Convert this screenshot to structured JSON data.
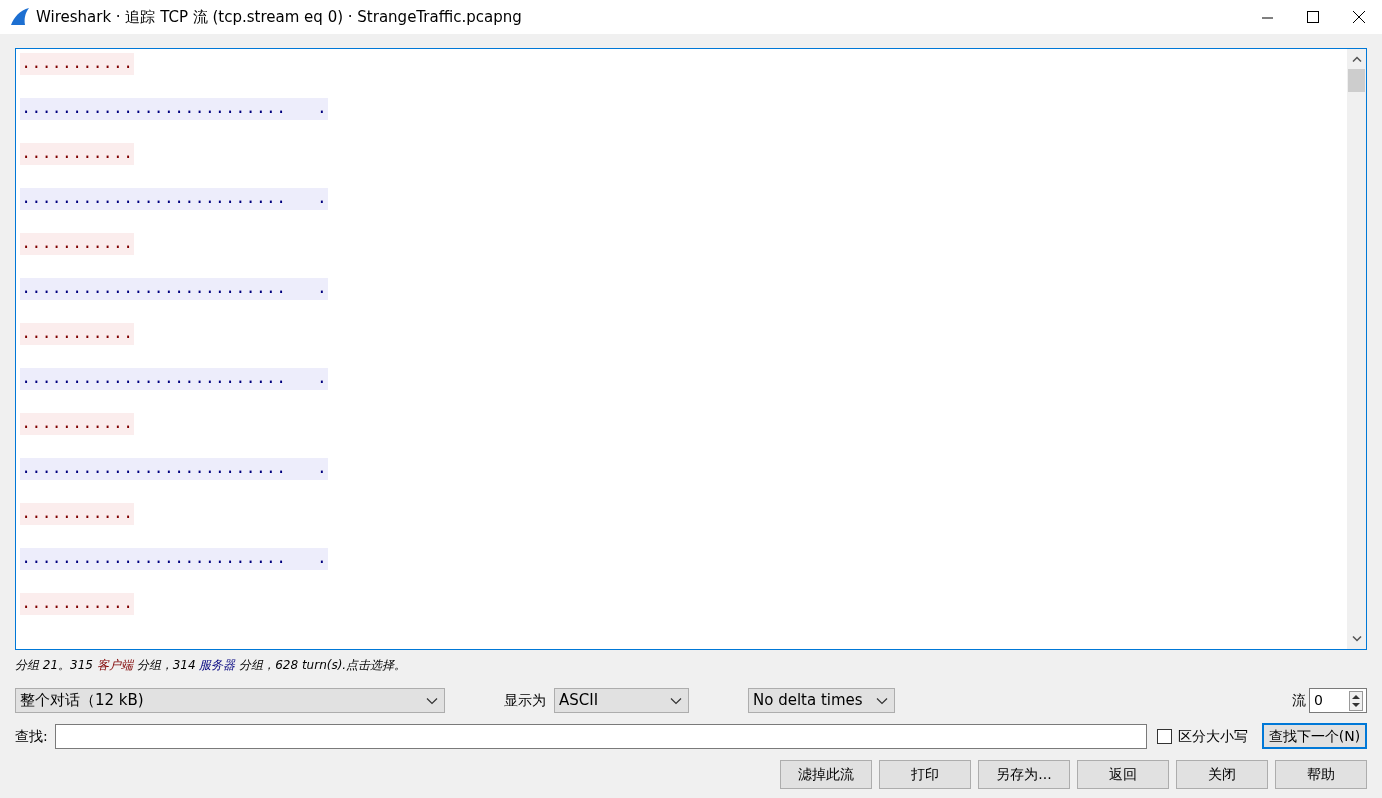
{
  "window": {
    "title": "Wireshark · 追踪 TCP 流 (tcp.stream eq 0) · StrangeTraffic.pcapng"
  },
  "stream": {
    "lines": [
      {
        "kind": "client",
        "text": "..........."
      },
      {
        "kind": "server",
        "text": "..........................   ."
      },
      {
        "kind": "client",
        "text": "..........."
      },
      {
        "kind": "server",
        "text": "..........................   ."
      },
      {
        "kind": "client",
        "text": "..........."
      },
      {
        "kind": "server",
        "text": "..........................   ."
      },
      {
        "kind": "client",
        "text": "..........."
      },
      {
        "kind": "server",
        "text": "..........................   ."
      },
      {
        "kind": "client",
        "text": "..........."
      },
      {
        "kind": "server",
        "text": "..........................   ."
      },
      {
        "kind": "client",
        "text": "..........."
      },
      {
        "kind": "server",
        "text": "..........................   ."
      },
      {
        "kind": "client",
        "text": "..........."
      }
    ]
  },
  "summary": {
    "segments": [
      {
        "kind": "plain",
        "text": "分组 21。315 "
      },
      {
        "kind": "client",
        "text": "客户端"
      },
      {
        "kind": "plain",
        "text": " 分组，314 "
      },
      {
        "kind": "server",
        "text": "服务器"
      },
      {
        "kind": "plain",
        "text": " 分组，628 turn(s).点击选择。"
      }
    ]
  },
  "conversation_select": {
    "value": "整个对话（12 kB)"
  },
  "show_as": {
    "label": "显示为",
    "value": "ASCII"
  },
  "delta_select": {
    "value": "No delta times"
  },
  "stream_number": {
    "label": "流",
    "value": "0"
  },
  "find": {
    "label": "查找:"
  },
  "case_sensitive": {
    "label": "区分大小写",
    "checked": false
  },
  "find_next": {
    "label": "查找下一个(N)",
    "focused": true
  },
  "buttons": [
    "滤掉此流",
    "打印",
    "另存为...",
    "返回",
    "关闭",
    "帮助"
  ]
}
